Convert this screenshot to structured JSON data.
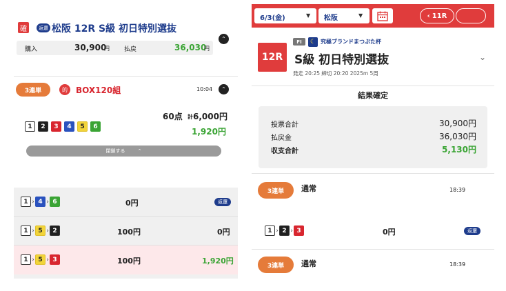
{
  "left": {
    "header": {
      "confirmed_badge": "確",
      "refund_badge": "返還",
      "title": "松阪 12R  S級 初日特別選抜"
    },
    "summary": {
      "purchase_label": "購入",
      "purchase_amount": "30,900",
      "purchase_unit": "円",
      "payout_label": "払戻",
      "payout_amount": "36,030",
      "payout_unit": "円"
    },
    "bet": {
      "type_label": "3連単",
      "win_badge": "的",
      "box_label": "BOX120組",
      "time": "10:04",
      "numbers": [
        "1",
        "2",
        "3",
        "4",
        "5",
        "6"
      ],
      "points": "60点",
      "total_prefix": "計",
      "total_amount": "6,000円",
      "payout": "1,920円",
      "toggle_label": "閉鎖する"
    },
    "rows": [
      {
        "n1": "1",
        "n2": "4",
        "n3": "6",
        "amount": "0円",
        "result": "返還"
      },
      {
        "n1": "1",
        "n2": "5",
        "n3": "2",
        "amount": "100円",
        "result": "0円"
      },
      {
        "n1": "1",
        "n2": "5",
        "n3": "3",
        "amount": "100円",
        "result": "1,920円"
      }
    ]
  },
  "right": {
    "topbar": {
      "date": "6/3(金)",
      "venue": "松阪",
      "race_button": "11R"
    },
    "race": {
      "number": "12R",
      "grade": "FI",
      "cup_name": "究極ブランドまつぶた杯",
      "title": "S級 初日特別選抜",
      "info": "発走 20:25 締切 20:20 2025m 5周"
    },
    "result": {
      "status": "結果確定",
      "total_bet_label": "投票合計",
      "total_bet": "30,900円",
      "payout_label": "払戻金",
      "payout": "36,030円",
      "balance_label": "収支合計",
      "balance": "5,130円"
    },
    "bets": [
      {
        "type_label": "3連単",
        "kind": "通常",
        "time": "18:39",
        "n1": "1",
        "n2": "2",
        "n3": "3",
        "amount": "0円",
        "result": "返還"
      },
      {
        "type_label": "3連単",
        "kind": "通常",
        "time": "18:39"
      }
    ]
  },
  "colors": {
    "accent_red": "#e03c3c",
    "orange": "#e57b3a",
    "green": "#3aa434",
    "refund_blue": "#1e3c8c"
  }
}
